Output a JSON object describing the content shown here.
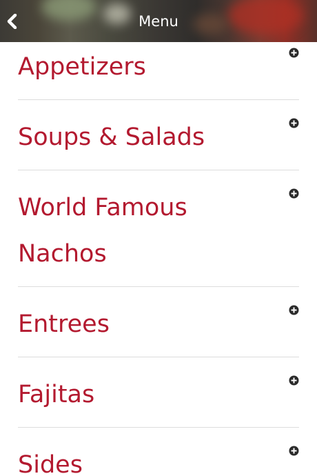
{
  "header": {
    "title": "Menu",
    "back_icon": "chevron-left-icon"
  },
  "menu": {
    "items": [
      {
        "label": "Appetizers",
        "icon": "plus-circle-icon"
      },
      {
        "label": "Soups & Salads",
        "icon": "plus-circle-icon"
      },
      {
        "label": "World Famous Nachos",
        "icon": "plus-circle-icon"
      },
      {
        "label": "Entrees",
        "icon": "plus-circle-icon"
      },
      {
        "label": "Fajitas",
        "icon": "plus-circle-icon"
      },
      {
        "label": "Sides",
        "icon": "plus-circle-icon"
      }
    ]
  },
  "colors": {
    "accent": "#b3192f",
    "header_text": "#ffffff",
    "icon": "#2a2a2a",
    "divider": "#dcdcdc"
  }
}
